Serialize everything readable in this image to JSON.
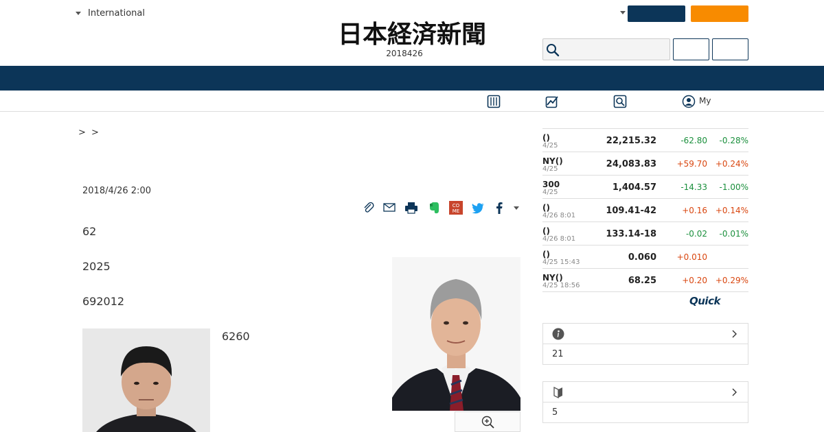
{
  "header": {
    "edition_label": "International",
    "logo_text": "日本経済新聞",
    "date": "2018426"
  },
  "subnav": {
    "my_label": "My"
  },
  "article": {
    "breadcrumb": ">  >",
    "published": "2018/4/26 2:00",
    "paragraphs": [
      "62",
      "2025",
      "692012",
      "6260"
    ]
  },
  "market": {
    "rows": [
      {
        "name": "()",
        "date": "4/25",
        "value": "22,215.32",
        "change": "-62.80",
        "percent": "-0.28%",
        "direction": "down"
      },
      {
        "name": "NY()",
        "date": "4/25",
        "value": "24,083.83",
        "change": "+59.70",
        "percent": "+0.24%",
        "direction": "up"
      },
      {
        "name": "300",
        "date": "4/25",
        "value": "1,404.57",
        "change": "-14.33",
        "percent": "-1.00%",
        "direction": "down"
      },
      {
        "name": "()",
        "date": "4/26 8:01",
        "value": "109.41-42",
        "change": "+0.16",
        "percent": "+0.14%",
        "direction": "up"
      },
      {
        "name": "()",
        "date": "4/26 8:01",
        "value": "133.14-18",
        "change": "-0.02",
        "percent": "-0.01%",
        "direction": "down"
      },
      {
        "name": "()",
        "date": "4/25 15:43",
        "value": "0.060",
        "change": "+0.010",
        "percent": "",
        "direction": "up"
      },
      {
        "name": "NY()",
        "date": "4/25 18:56",
        "value": "68.25",
        "change": "+0.20",
        "percent": "+0.29%",
        "direction": "up"
      }
    ],
    "provider": "Quick"
  },
  "boxes": [
    {
      "icon": "info-icon",
      "body": "21"
    },
    {
      "icon": "beginner-mark-icon",
      "body": "5"
    }
  ],
  "colors": {
    "navy": "#0c3558",
    "orange": "#f88b00",
    "up": "#d9460f",
    "down": "#1a8f3c"
  }
}
